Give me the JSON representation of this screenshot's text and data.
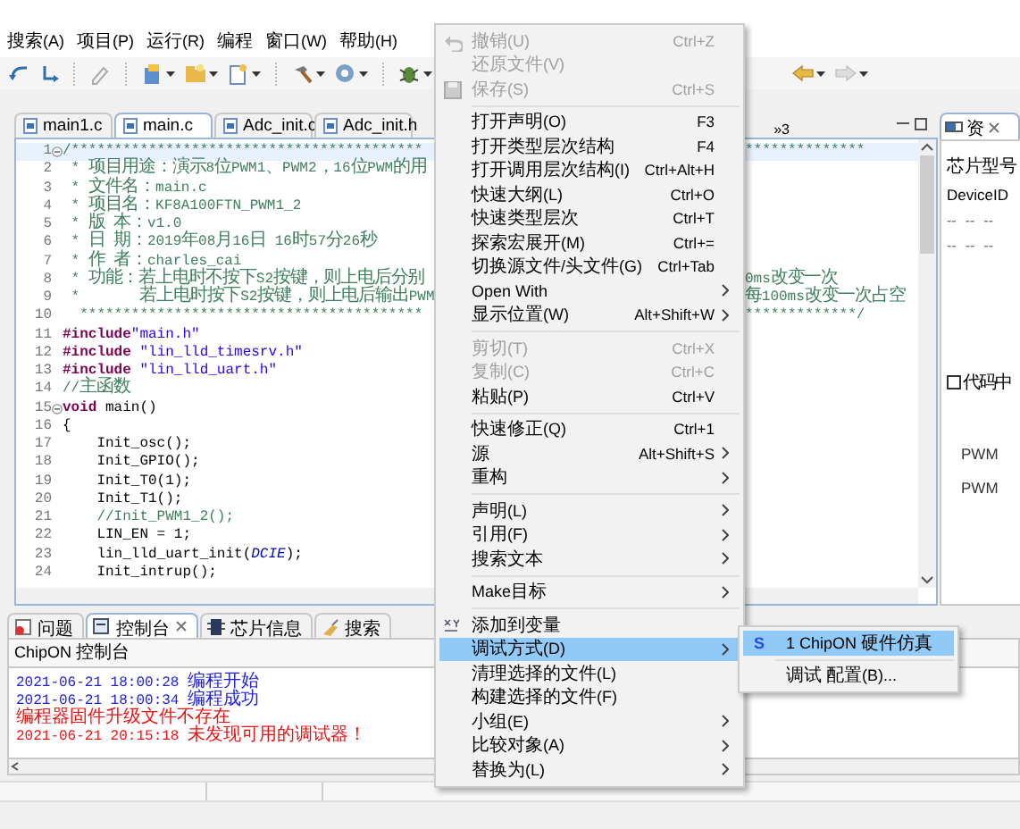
{
  "menubar": {
    "items": [
      "搜索(A)",
      "项目(P)",
      "运行(R)",
      "编程",
      "窗口(W)",
      "帮助(H)"
    ]
  },
  "editor": {
    "tabs": [
      {
        "label": "main1.c",
        "selected": false
      },
      {
        "label": "main.c",
        "selected": true
      },
      {
        "label": "Adc_init.c",
        "selected": false
      },
      {
        "label": "Adc_init.h",
        "selected": false
      }
    ],
    "overflow": "»3",
    "lines": [
      {
        "number": "1",
        "fold": true,
        "current": true,
        "segments": [
          {
            "kind": "comment",
            "text": "/*****************************************"
          }
        ],
        "tail": "**************"
      },
      {
        "number": "2",
        "fold": false,
        "current": false,
        "segments": [
          {
            "kind": "comment",
            "text": " * 项目用途：演示8位PWM1、PWM2，16位PWM的用"
          }
        ]
      },
      {
        "number": "3",
        "fold": false,
        "current": false,
        "segments": [
          {
            "kind": "comment",
            "text": " * 文件名：main.c"
          }
        ]
      },
      {
        "number": "4",
        "fold": false,
        "current": false,
        "segments": [
          {
            "kind": "comment",
            "text": " * 项目名：KF8A100FTN_PWM1_2"
          }
        ]
      },
      {
        "number": "5",
        "fold": false,
        "current": false,
        "segments": [
          {
            "kind": "comment",
            "text": " * 版 本：v1.0"
          }
        ]
      },
      {
        "number": "6",
        "fold": false,
        "current": false,
        "segments": [
          {
            "kind": "comment",
            "text": " * 日 期：2019年08月16日 16时57分26秒"
          }
        ]
      },
      {
        "number": "7",
        "fold": false,
        "current": false,
        "segments": [
          {
            "kind": "comment",
            "text": " * 作 者：charles_cai"
          }
        ]
      },
      {
        "number": "8",
        "fold": false,
        "current": false,
        "segments": [
          {
            "kind": "comment",
            "text": " * 功能：若上电时不按下S2按键，则上电后分别"
          }
        ],
        "tail": "0ms改变一次"
      },
      {
        "number": "9",
        "fold": false,
        "current": false,
        "segments": [
          {
            "kind": "comment",
            "text": " *       若上电时按下S2按键，则上电后输出PWM"
          }
        ],
        "tail": "每100ms改变一次占空"
      },
      {
        "number": "10",
        "fold": false,
        "current": false,
        "segments": [
          {
            "kind": "comment",
            "text": "  ****************************************"
          }
        ],
        "tail": "*************/"
      },
      {
        "number": "11",
        "fold": false,
        "current": false,
        "segments": [
          {
            "kind": "directive",
            "text": "#include"
          },
          {
            "kind": "string",
            "text": "\"main.h\""
          }
        ]
      },
      {
        "number": "12",
        "fold": false,
        "current": false,
        "segments": [
          {
            "kind": "directive",
            "text": "#include "
          },
          {
            "kind": "string",
            "text": "\"lin_lld_timesrv.h\""
          }
        ]
      },
      {
        "number": "13",
        "fold": false,
        "current": false,
        "segments": [
          {
            "kind": "directive",
            "text": "#include "
          },
          {
            "kind": "string",
            "text": "\"lin_lld_uart.h\""
          }
        ]
      },
      {
        "number": "14",
        "fold": false,
        "current": false,
        "segments": [
          {
            "kind": "comment",
            "text": "//主函数"
          }
        ]
      },
      {
        "number": "15",
        "fold": true,
        "current": false,
        "segments": [
          {
            "kind": "keyword",
            "text": "void"
          },
          {
            "kind": "code",
            "text": " main()"
          }
        ]
      },
      {
        "number": "16",
        "fold": false,
        "current": false,
        "segments": [
          {
            "kind": "code",
            "text": "{"
          }
        ]
      },
      {
        "number": "17",
        "fold": false,
        "current": false,
        "segments": [
          {
            "kind": "code",
            "text": "    Init_osc();"
          }
        ]
      },
      {
        "number": "18",
        "fold": false,
        "current": false,
        "segments": [
          {
            "kind": "code",
            "text": "    Init_GPIO();"
          }
        ]
      },
      {
        "number": "19",
        "fold": false,
        "current": false,
        "segments": [
          {
            "kind": "code",
            "text": "    Init_T0(1);"
          }
        ]
      },
      {
        "number": "20",
        "fold": false,
        "current": false,
        "segments": [
          {
            "kind": "code",
            "text": "    Init_T1();"
          }
        ]
      },
      {
        "number": "21",
        "fold": false,
        "current": false,
        "segments": [
          {
            "kind": "comment",
            "text": "    //Init_PWM1_2();"
          }
        ]
      },
      {
        "number": "22",
        "fold": false,
        "current": false,
        "segments": [
          {
            "kind": "code",
            "text": "    LIN_EN = 1;"
          }
        ]
      },
      {
        "number": "23",
        "fold": false,
        "current": false,
        "segments": [
          {
            "kind": "code",
            "text": "    lin_lld_uart_init("
          },
          {
            "kind": "macro",
            "text": "DCIE"
          },
          {
            "kind": "code",
            "text": ");"
          }
        ]
      },
      {
        "number": "24",
        "fold": false,
        "current": false,
        "segments": [
          {
            "kind": "code",
            "text": "    Init_intrup();"
          }
        ]
      }
    ]
  },
  "side_panel": {
    "tab": "资",
    "labels": [
      "芯片型号",
      "DeviceID"
    ],
    "readings": [
      [
        "--",
        "--",
        "--"
      ],
      [
        "--",
        "--",
        "--"
      ]
    ],
    "checkbox": {
      "label": "代码中",
      "checked": false
    },
    "fields": [
      "PWM",
      "PWM"
    ]
  },
  "console": {
    "tabs": [
      {
        "label": "问题",
        "selected": false
      },
      {
        "label": "控制台",
        "selected": true
      },
      {
        "label": "芯片信息",
        "selected": false
      },
      {
        "label": "搜索",
        "selected": false
      }
    ],
    "title": "ChipON 控制台",
    "lines": [
      {
        "kind": "info",
        "time": "2021-06-21 18:00:28",
        "message": "编程开始"
      },
      {
        "kind": "info",
        "time": "2021-06-21 18:00:34",
        "message": "编程成功"
      },
      {
        "kind": "error",
        "message": "编程器固件升级文件不存在"
      },
      {
        "kind": "error",
        "time": "2021-06-21 20:15:18",
        "message": "未发现可用的调试器！"
      }
    ]
  },
  "context_menu": {
    "items": [
      {
        "kind": "undo",
        "label": "撤销(U)",
        "shortcut": "Ctrl+Z",
        "disabled": true,
        "submenu": false,
        "selected": false
      },
      {
        "kind": "item",
        "label": "还原文件(V)",
        "disabled": true,
        "submenu": false,
        "selected": false
      },
      {
        "kind": "save",
        "label": "保存(S)",
        "shortcut": "Ctrl+S",
        "disabled": true,
        "submenu": false,
        "selected": false
      },
      {
        "kind": "separator"
      },
      {
        "kind": "item",
        "label": "打开声明(O)",
        "shortcut": "F3",
        "disabled": false,
        "submenu": false,
        "selected": false
      },
      {
        "kind": "item",
        "label": "打开类型层次结构",
        "shortcut": "F4",
        "disabled": false,
        "submenu": false,
        "selected": false
      },
      {
        "kind": "item",
        "label": "打开调用层次结构(I)",
        "shortcut": "Ctrl+Alt+H",
        "disabled": false,
        "submenu": false,
        "selected": false
      },
      {
        "kind": "item",
        "label": "快速大纲(L)",
        "shortcut": "Ctrl+O",
        "disabled": false,
        "submenu": false,
        "selected": false
      },
      {
        "kind": "item",
        "label": "快速类型层次",
        "shortcut": "Ctrl+T",
        "disabled": false,
        "submenu": false,
        "selected": false
      },
      {
        "kind": "item",
        "label": "探索宏展开(M)",
        "shortcut": "Ctrl+=",
        "disabled": false,
        "submenu": false,
        "selected": false
      },
      {
        "kind": "item",
        "label": "切换源文件/头文件(G)",
        "shortcut": "Ctrl+Tab",
        "disabled": false,
        "submenu": false,
        "selected": false
      },
      {
        "kind": "item",
        "label": "Open With",
        "disabled": false,
        "submenu": true,
        "selected": false
      },
      {
        "kind": "item",
        "label": "显示位置(W)",
        "shortcut": "Alt+Shift+W",
        "disabled": false,
        "submenu": true,
        "selected": false
      },
      {
        "kind": "separator"
      },
      {
        "kind": "item",
        "label": "剪切(T)",
        "shortcut": "Ctrl+X",
        "disabled": true,
        "submenu": false,
        "selected": false
      },
      {
        "kind": "item",
        "label": "复制(C)",
        "shortcut": "Ctrl+C",
        "disabled": true,
        "submenu": false,
        "selected": false
      },
      {
        "kind": "item",
        "label": "粘贴(P)",
        "shortcut": "Ctrl+V",
        "disabled": false,
        "submenu": false,
        "selected": false
      },
      {
        "kind": "separator"
      },
      {
        "kind": "item",
        "label": "快速修正(Q)",
        "shortcut": "Ctrl+1",
        "disabled": false,
        "submenu": false,
        "selected": false
      },
      {
        "kind": "item",
        "label": "源",
        "shortcut": "Alt+Shift+S",
        "disabled": false,
        "submenu": true,
        "selected": false
      },
      {
        "kind": "item",
        "label": "重构",
        "disabled": false,
        "submenu": true,
        "selected": false
      },
      {
        "kind": "separator"
      },
      {
        "kind": "item",
        "label": "声明(L)",
        "disabled": false,
        "submenu": true,
        "selected": false
      },
      {
        "kind": "item",
        "label": "引用(F)",
        "disabled": false,
        "submenu": true,
        "selected": false
      },
      {
        "kind": "item",
        "label": "搜索文本",
        "disabled": false,
        "submenu": true,
        "selected": false
      },
      {
        "kind": "separator"
      },
      {
        "kind": "item",
        "label": "Make目标",
        "disabled": false,
        "submenu": true,
        "selected": false
      },
      {
        "kind": "separator"
      },
      {
        "kind": "variable",
        "label": "添加到变量",
        "disabled": false,
        "submenu": false,
        "selected": false
      },
      {
        "kind": "item",
        "label": "调试方式(D)",
        "disabled": false,
        "submenu": true,
        "selected": true
      },
      {
        "kind": "item",
        "label": "清理选择的文件(L)",
        "disabled": false,
        "submenu": false,
        "selected": false
      },
      {
        "kind": "item",
        "label": "构建选择的文件(F)",
        "disabled": false,
        "submenu": false,
        "selected": false
      },
      {
        "kind": "item",
        "label": "小组(E)",
        "disabled": false,
        "submenu": true,
        "selected": false
      },
      {
        "kind": "item",
        "label": "比较对象(A)",
        "disabled": false,
        "submenu": true,
        "selected": false
      },
      {
        "kind": "item",
        "label": "替换为(L)",
        "disabled": false,
        "submenu": true,
        "selected": false
      }
    ]
  },
  "submenu": {
    "items": [
      {
        "kind": "launch",
        "badge": "S",
        "label": "1 ChipON 硬件仿真",
        "selected": true
      },
      {
        "kind": "separator"
      },
      {
        "kind": "item",
        "label": "调试 配置(B)...",
        "selected": false
      }
    ]
  }
}
